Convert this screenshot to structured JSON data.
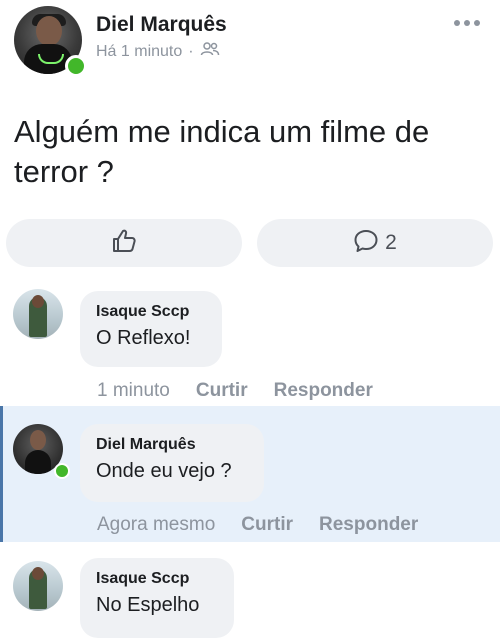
{
  "post": {
    "author": "Diel Marquês",
    "time": "Há 1 minuto",
    "separator": "·",
    "audience_icon": "friends-icon",
    "more_icon": "more-options-icon",
    "text": "Alguém me indica um filme de terror ?"
  },
  "reactions": {
    "like_icon": "thumbs-up-icon",
    "comment_icon": "comment-icon",
    "comment_count": "2"
  },
  "comments": [
    {
      "author": "Isaque Sccp",
      "text": "O Reflexo!",
      "time": "1 minuto",
      "like_label": "Curtir",
      "reply_label": "Responder"
    },
    {
      "author": "Diel Marquês",
      "text": "Onde eu vejo ?",
      "time": "Agora mesmo",
      "like_label": "Curtir",
      "reply_label": "Responder",
      "highlighted": true
    },
    {
      "author": "Isaque Sccp",
      "text": "No Espelho"
    }
  ],
  "colors": {
    "online": "#42b72a",
    "bubble": "#eff1f4",
    "highlight": "#e7f0fa",
    "muted_text": "#8d949e"
  }
}
